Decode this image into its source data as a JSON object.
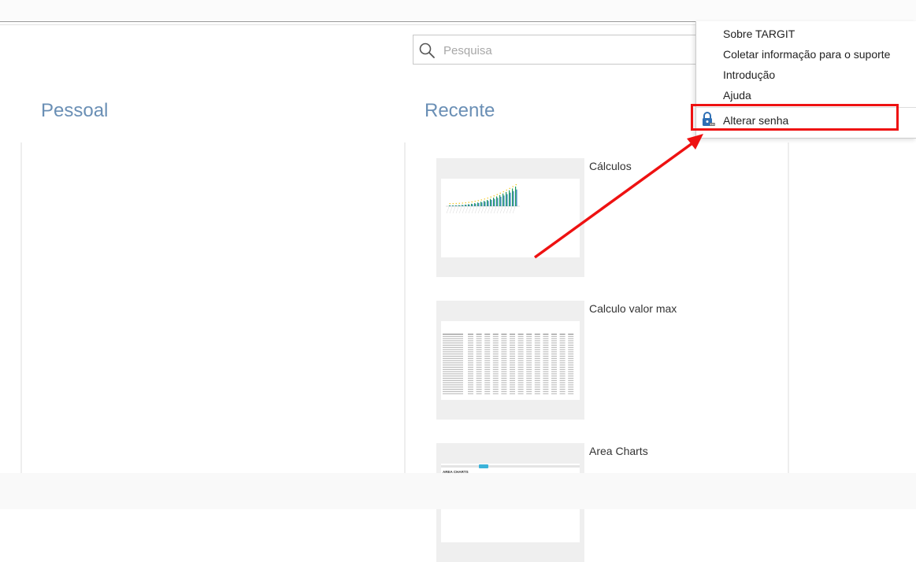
{
  "search": {
    "placeholder": "Pesquisa"
  },
  "sections": {
    "personal": "Pessoal",
    "recent": "Recente"
  },
  "recent_items": [
    {
      "title": "Cálculos",
      "thumb_type": "bar-chart"
    },
    {
      "title": "Calculo valor max",
      "thumb_type": "table"
    },
    {
      "title": "Area Charts",
      "thumb_type": "area-chart",
      "thumb_label": "AREA CHARTS"
    }
  ],
  "menu": {
    "items": [
      {
        "label": "Sobre TARGIT"
      },
      {
        "label": "Coletar informação para o suporte"
      },
      {
        "label": "Introdução"
      },
      {
        "label": "Ajuda"
      },
      {
        "label": "Alterar senha",
        "icon": "lock-icon"
      }
    ]
  },
  "colors": {
    "accent_title": "#6a8fb5",
    "highlight": "#ee1111",
    "bar_green": "#1e9a5a",
    "bar_blue": "#2a7ab8",
    "bar_yellow": "#f0c419",
    "lock_blue": "#2e6fb5"
  }
}
